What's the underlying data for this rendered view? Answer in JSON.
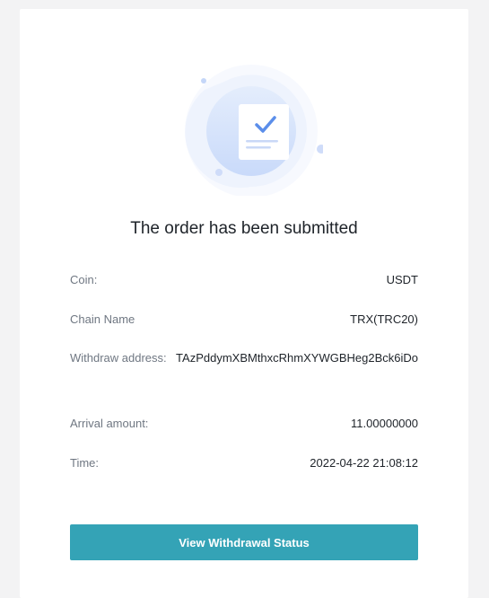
{
  "confirmation": {
    "title": "The order has been submitted",
    "icon": "document-check-icon"
  },
  "details": {
    "coin": {
      "label": "Coin:",
      "value": "USDT"
    },
    "chain": {
      "label": "Chain Name",
      "value": "TRX(TRC20)"
    },
    "address": {
      "label": "Withdraw address:",
      "value": "TAzPddymXBMthxcRhmXYWGBHeg2Bck6iDo"
    },
    "amount": {
      "label": "Arrival amount:",
      "value": "11.00000000"
    },
    "time": {
      "label": "Time:",
      "value": "2022-04-22 21:08:12"
    }
  },
  "actions": {
    "view_status_label": "View Withdrawal Status"
  },
  "colors": {
    "button": "#34a3b6",
    "icon_primary": "#5b8eea",
    "icon_light": "#dfe8fb"
  }
}
